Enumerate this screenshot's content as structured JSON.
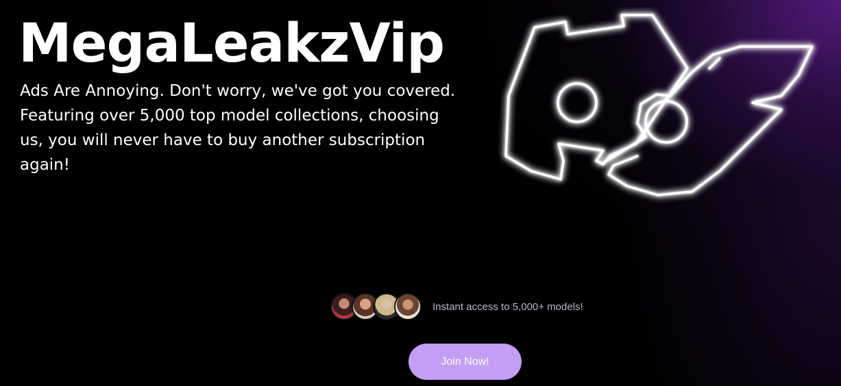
{
  "hero": {
    "title": "MegaLeakzVip",
    "tagline": "Ads Are Annoying. Don't worry, we've got you covered. Featuring over 5,000 top model collections, choosing us, you will never have to buy another subscription again!"
  },
  "logo": {
    "icon": "neon-game-controller-leaf-logo-icon",
    "glow_color": "#ffffff"
  },
  "social_proof": {
    "avatar_count": 4,
    "text": "Instant access to 5,000+ models!"
  },
  "cta": {
    "join_label": "Join Now!"
  },
  "colors": {
    "background": "#000000",
    "accent_glow": "#5c1e8c",
    "button": "#c49ef5",
    "text": "#ffffff",
    "muted_text": "#b9b9c8"
  }
}
